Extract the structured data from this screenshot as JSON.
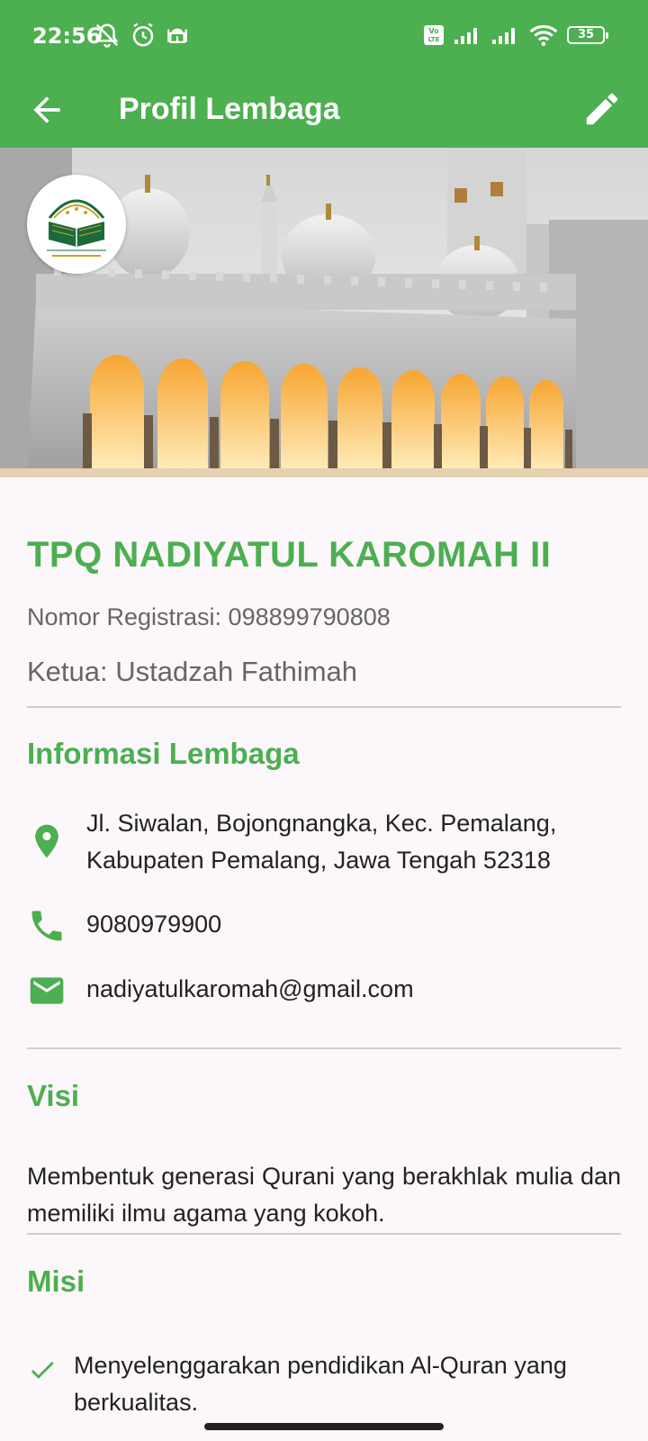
{
  "status_bar": {
    "time": "22:56",
    "battery": "35",
    "icons": [
      "mute-bell-icon",
      "alarm-icon",
      "mosque-icon",
      "volte-icon",
      "signal-icon",
      "signal-icon",
      "wifi-icon",
      "battery-icon"
    ]
  },
  "app_bar": {
    "title": "Profil Lembaga",
    "back_icon": "arrow-back-icon",
    "edit_icon": "edit-pencil-icon"
  },
  "colors": {
    "primary": "#4caf50",
    "background": "#fcf7fb",
    "divider": "#cfcfcf",
    "secondary_text": "#666666"
  },
  "profile": {
    "name": "TPQ NADIYATUL KAROMAH II",
    "registration": "Nomor Registrasi: 098899790808",
    "leader": "Ketua: Ustadzah Fathimah"
  },
  "info": {
    "title": "Informasi Lembaga",
    "address_line1": "Jl. Siwalan, Bojongnangka, Kec. Pemalang,",
    "address_line2": "Kabupaten Pemalang, Jawa Tengah 52318",
    "phone": "9080979900",
    "email": "nadiyatulkaromah@gmail.com"
  },
  "visi": {
    "title": "Visi",
    "text": "Membentuk generasi Qurani yang berakhlak mulia dan memiliki ilmu agama yang kokoh."
  },
  "misi": {
    "title": "Misi",
    "items": [
      "Menyelenggarakan pendidikan Al-Quran yang berkualitas."
    ]
  }
}
